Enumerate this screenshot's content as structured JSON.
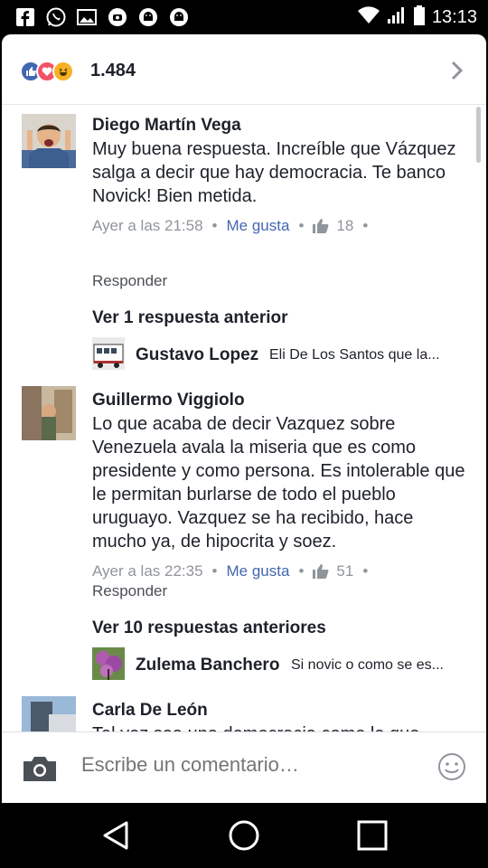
{
  "status_bar": {
    "time": "13:13",
    "left_icons": [
      "facebook-icon",
      "whatsapp-icon",
      "gallery-icon",
      "line-icon",
      "android-icon",
      "android-icon"
    ],
    "right_icons": [
      "wifi-icon",
      "signal-icon",
      "battery-icon"
    ]
  },
  "reactions": {
    "count": "1.484",
    "icons": [
      "like-reaction-icon",
      "love-reaction-icon",
      "haha-reaction-icon"
    ]
  },
  "comments": [
    {
      "author": "Diego Martín Vega",
      "text": "Muy buena respuesta. Increíble que Vázquez salga a decir que hay democracia. Te banco Novick! Bien metida.",
      "time": "Ayer a las 21:58",
      "like_label": "Me gusta",
      "likes": "18",
      "reply_label": "Responder",
      "more_replies": "Ver 1 respuesta anterior",
      "reply_preview": {
        "author": "Gustavo Lopez",
        "text": "Eli De Los Santos que la..."
      }
    },
    {
      "author": "Guillermo Viggiolo",
      "text": "Lo que acaba de decir Vazquez sobre Venezuela avala la miseria que es como presidente y como persona. Es intolerable que le permitan burlarse de todo el pueblo uruguayo. Vazquez se ha recibido, hace mucho ya, de hipocrita y soez.",
      "time": "Ayer a las 22:35",
      "like_label": "Me gusta",
      "likes": "51",
      "reply_label": "Responder",
      "more_replies": "Ver 10 respuestas anteriores",
      "reply_preview": {
        "author": "Zulema Banchero",
        "text": "Si novic o como se es..."
      }
    },
    {
      "author": "Carla De León",
      "text": "Tal vez sea una democracia como la que concibe el FA .. donde lo político está x"
    }
  ],
  "composer": {
    "placeholder": "Escribe un comentario…"
  },
  "colors": {
    "link_blue": "#4267b2",
    "like_blue": "#3b5998",
    "love_red": "#f25268",
    "haha_yellow": "#f7b125"
  }
}
